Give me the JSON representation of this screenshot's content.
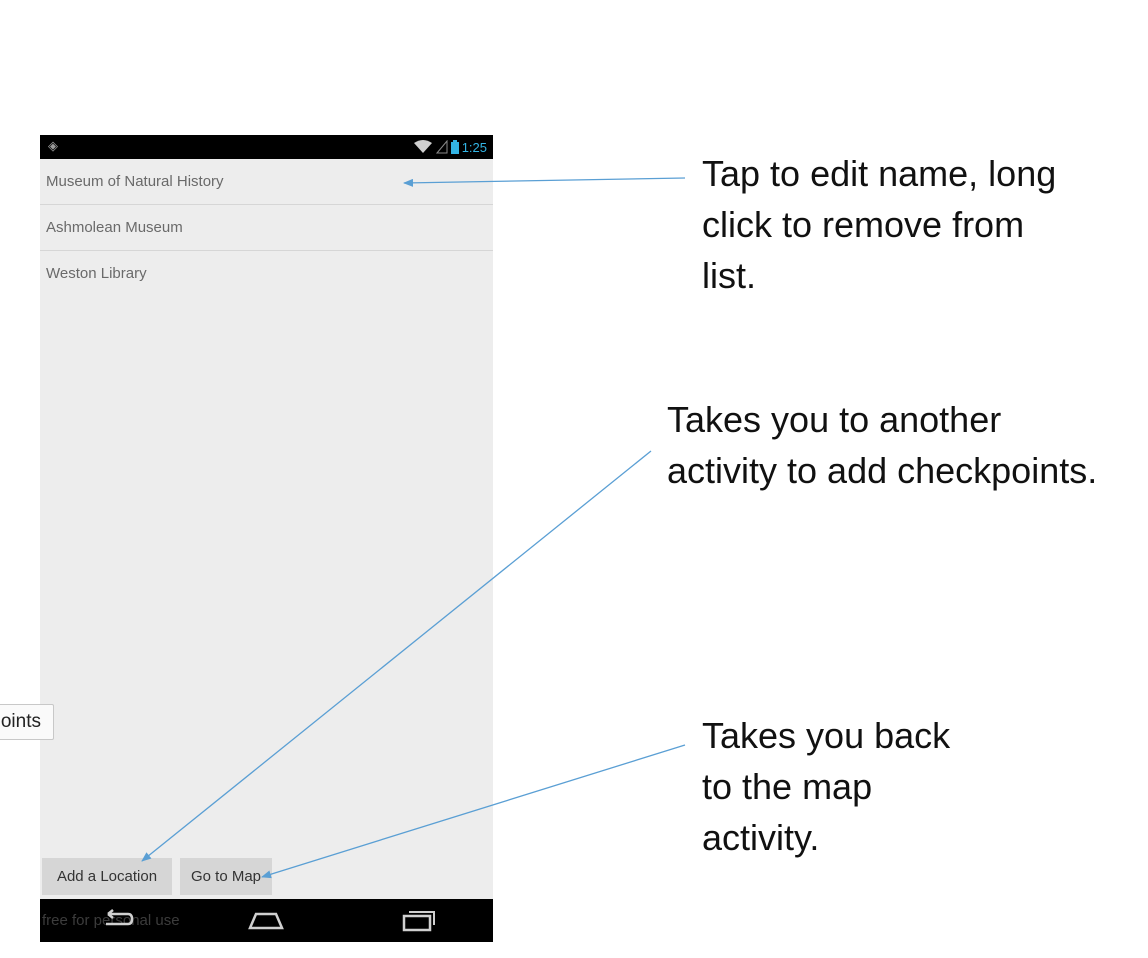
{
  "status": {
    "time": "1:25"
  },
  "list": [
    {
      "label": "Museum of Natural History"
    },
    {
      "label": "Ashmolean Museum"
    },
    {
      "label": "Weston Library"
    }
  ],
  "buttons": {
    "add_location": "Add a Location",
    "go_to_map": "Go to Map"
  },
  "navbar": {
    "watermark": "free for personal use"
  },
  "annotations": {
    "edit_note": [
      "Tap to edit name, long",
      "click to remove from",
      "list."
    ],
    "add_note": [
      "Takes you to another",
      "activity to add checkpoints."
    ],
    "map_note": [
      "Takes you back",
      "to the map",
      "activity."
    ]
  },
  "tooltip": {
    "text": "oints"
  },
  "colors": {
    "arrow": "#5a9fd4",
    "status_time": "#33b5e5",
    "screen_bg": "#ededed"
  }
}
